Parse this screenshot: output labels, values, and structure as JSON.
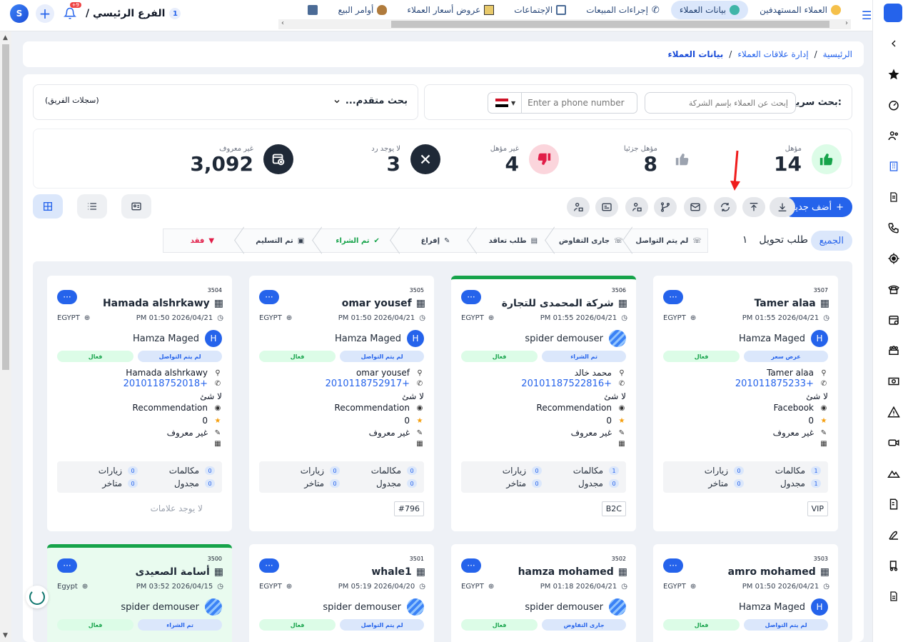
{
  "topbar": {
    "branch_num": "1",
    "branch_name": "الفرع الرئيسي /",
    "notif_count": "+9",
    "tabs": [
      {
        "label": "العملاء المستهدفين"
      },
      {
        "label": "بيانات العملاء"
      },
      {
        "label": "إجراءات المبيعات"
      },
      {
        "label": "الإجتماعات"
      },
      {
        "label": "عروض أسعار العملاء"
      },
      {
        "label": "أوامر البيع"
      }
    ]
  },
  "breadcrumb": {
    "home": "الرئيسية",
    "crm": "إدارة علاقات العملاء",
    "current": "بيانات العملاء",
    "sep": "/"
  },
  "search": {
    "label": "بحث سريع:",
    "company_placeholder": "إبحث عن العملاء بإسم الشركة",
    "phone_placeholder": "Enter a phone number",
    "advanced": "بحث متقدم...",
    "team": "(سجلات الفريق)"
  },
  "stats": {
    "qualified": {
      "label": "مؤهل",
      "value": "14"
    },
    "partial": {
      "label": "مؤهل جزئيا",
      "value": "8"
    },
    "unqualified": {
      "label": "غير مؤهل",
      "value": "4"
    },
    "noreply": {
      "label": "لا يوجد رد",
      "value": "3"
    },
    "unknown": {
      "label": "غير معروف",
      "value": "3,092"
    }
  },
  "toolbar": {
    "add_new": "أضف جديد"
  },
  "pipeline": {
    "all": "الجميع",
    "request": "طلب تحويل",
    "request_count": "١",
    "stages": [
      {
        "label": "لم يتم التواصل"
      },
      {
        "label": "جارى التفاوض"
      },
      {
        "label": "طلب تعاقد"
      },
      {
        "label": "إفراغ"
      },
      {
        "label": "تم الشراء"
      },
      {
        "label": "تم التسليم"
      },
      {
        "label": "فقد"
      }
    ]
  },
  "card_labels": {
    "calls": "مكالمات",
    "visits": "زيارات",
    "scheduled": "مجدول",
    "late": "متاخر",
    "no_notes": "لا يوجد علامات",
    "none": "لا شئ",
    "unknown": "غير معروف",
    "more": "···"
  },
  "cards": [
    {
      "id": "3507",
      "name": "Tamer alaa",
      "date": "2026/04/21 01:55 PM",
      "country": "EGYPT",
      "owner": "Hamza Maged",
      "owner_initial": "H",
      "stage": "عرض سعر",
      "status": "فعال",
      "contact": "Tamer alaa",
      "phone": "+201011875233",
      "source": "Facebook",
      "rating": "0",
      "calls": "1",
      "visits": "0",
      "scheduled": "1",
      "late": "0",
      "tag": "VIP"
    },
    {
      "id": "3506",
      "name": "شركة المحمدى للتجارة",
      "date": "2026/04/21 01:55 PM",
      "country": "EGYPT",
      "owner": "spider demouser",
      "owner_initial": "",
      "stage": "تم الشراء",
      "status": "فعال",
      "contact": "محمد خالد",
      "phone": "+201011875228​16",
      "source": "Recommendation",
      "rating": "0",
      "calls": "1",
      "visits": "0",
      "scheduled": "0",
      "late": "0",
      "tag": "B2C"
    },
    {
      "id": "3505",
      "name": "omar yousef",
      "date": "2026/04/21 01:50 PM",
      "country": "EGYPT",
      "owner": "Hamza Maged",
      "owner_initial": "H",
      "stage": "لم يتم التواصل",
      "status": "فعال",
      "contact": "omar yousef",
      "phone": "+201011875291​7",
      "source": "Recommendation",
      "rating": "0",
      "calls": "0",
      "visits": "0",
      "scheduled": "0",
      "late": "0",
      "tag": "#796"
    },
    {
      "id": "3504",
      "name": "Hamada alshrkawy",
      "date": "2026/04/21 01:50 PM",
      "country": "EGYPT",
      "owner": "Hamza Maged",
      "owner_initial": "H",
      "stage": "لم يتم التواصل",
      "status": "فعال",
      "contact": "Hamada alshrkawy",
      "phone": "+201011875201​8",
      "source": "Recommendation",
      "rating": "0",
      "calls": "0",
      "visits": "0",
      "scheduled": "0",
      "late": "0",
      "tag": ""
    },
    {
      "id": "3503",
      "name": "amro mohamed",
      "date": "2026/04/21 01:50 PM",
      "country": "EGYPT",
      "owner": "Hamza Maged",
      "owner_initial": "H",
      "stage": "لم يتم التواصل",
      "status": "فعال"
    },
    {
      "id": "3502",
      "name": "hamza mohamed",
      "date": "2026/04/21 01:18 PM",
      "country": "EGYPT",
      "owner": "spider demouser",
      "owner_initial": "",
      "stage": "جارى التفاوض",
      "status": "فعال"
    },
    {
      "id": "3501",
      "name": "whale1",
      "date": "2026/04/20 05:19 PM",
      "country": "EGYPT",
      "owner": "spider demouser",
      "owner_initial": "",
      "stage": "لم يتم التواصل",
      "status": "فعال"
    },
    {
      "id": "3500",
      "name": "أسامة الصعيدى",
      "date": "2026/04/15 03:52 PM",
      "country": "Egypt",
      "owner": "spider demouser",
      "owner_initial": "",
      "stage": "تم الشراء",
      "status": "فعال"
    }
  ],
  "colors": {
    "primary": "#2563eb",
    "green": "#16a34a",
    "red": "#e11d48",
    "dark": "#1f2937"
  }
}
